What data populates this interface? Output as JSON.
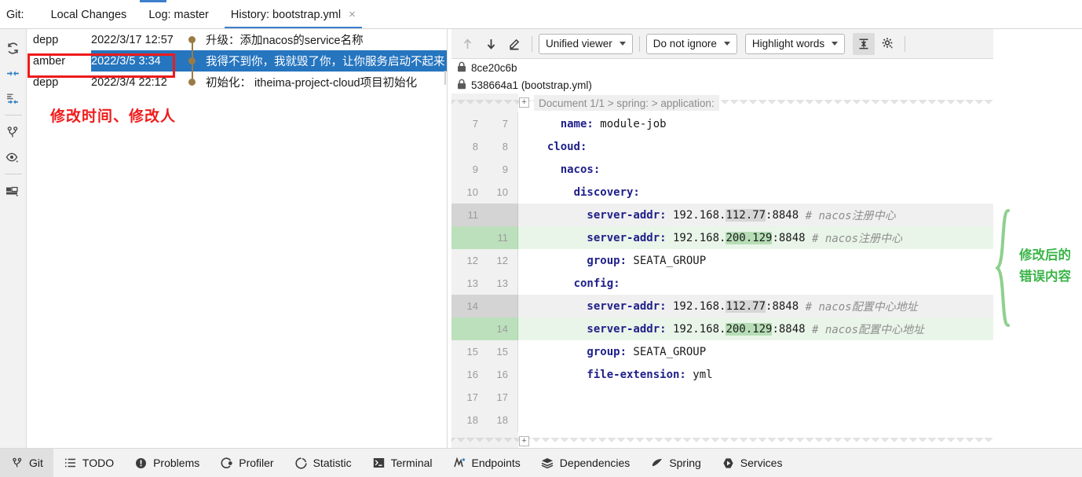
{
  "tabbar": {
    "git_label": "Git:",
    "tabs": [
      {
        "label": "Local Changes",
        "active": false
      },
      {
        "label": "Log: master",
        "active": false
      },
      {
        "label": "History: bootstrap.yml",
        "active": true,
        "close": "×"
      }
    ]
  },
  "rail": {
    "icons": [
      {
        "name": "refresh-icon"
      },
      {
        "name": "collapse-all-icon"
      },
      {
        "name": "expand-selection-icon"
      },
      {
        "name": "branch-icon"
      },
      {
        "name": "eye-icon"
      },
      {
        "name": "layout-icon"
      }
    ]
  },
  "history": {
    "rows": [
      {
        "author": "depp",
        "date": "2022/3/17 12:57",
        "message": "升级：添加nacos的service名称",
        "selected": false
      },
      {
        "author": "amber",
        "date": "2022/3/5 3:34",
        "message": "我得不到你，我就毁了你，让你服务启动不起来",
        "selected": true
      },
      {
        "author": "depp",
        "date": "2022/3/4 22:12",
        "message": "初始化： itheima-project-cloud项目初始化",
        "selected": false
      }
    ]
  },
  "annotations": {
    "left_red_text": "修改时间、修改人",
    "left_red_color": "#f01c1c",
    "right_green_line1": "修改后的",
    "right_green_line2": "错误内容",
    "right_green_color": "#3cb54a"
  },
  "diff": {
    "toolbar": {
      "prev_diff": "up-arrow-icon",
      "next_diff": "down-arrow-icon",
      "edit_source": "pencil-icon",
      "viewer_mode": "Unified viewer",
      "ignore_mode": "Do not ignore",
      "highlight_mode": "Highlight words",
      "collapse_unchanged": "collapse-lines-icon",
      "settings": "gear-icon"
    },
    "revisions": [
      {
        "icon": "lock-icon",
        "label": "8ce20c6b"
      },
      {
        "icon": "lock-icon",
        "label": "538664a1 (bootstrap.yml)"
      }
    ],
    "breadcrumb": "Document 1/1 > spring: > application:",
    "fold_button": "+",
    "lines": [
      {
        "kind": "ctx",
        "ln_left": "7",
        "ln_right": "7",
        "indent": 4,
        "key": "name:",
        "value": " module-job",
        "comment": ""
      },
      {
        "kind": "ctx",
        "ln_left": "8",
        "ln_right": "8",
        "indent": 2,
        "key": "cloud:",
        "value": "",
        "comment": ""
      },
      {
        "kind": "ctx",
        "ln_left": "9",
        "ln_right": "9",
        "indent": 4,
        "key": "nacos:",
        "value": "",
        "comment": ""
      },
      {
        "kind": "ctx",
        "ln_left": "10",
        "ln_right": "10",
        "indent": 6,
        "key": "discovery:",
        "value": "",
        "comment": ""
      },
      {
        "kind": "del",
        "ln_left": "11",
        "ln_right": "",
        "indent": 8,
        "key": "server-addr:",
        "value_pre": " 192.168.",
        "value_hl": "112.77",
        "value_post": ":8848",
        "comment": " # nacos注册中心"
      },
      {
        "kind": "add",
        "ln_left": "",
        "ln_right": "11",
        "indent": 8,
        "key": "server-addr:",
        "value_pre": " 192.168.",
        "value_hl": "200.129",
        "value_post": ":8848",
        "comment": " # nacos注册中心"
      },
      {
        "kind": "ctx",
        "ln_left": "12",
        "ln_right": "12",
        "indent": 8,
        "key": "group:",
        "value": " SEATA_GROUP",
        "comment": ""
      },
      {
        "kind": "ctx",
        "ln_left": "13",
        "ln_right": "13",
        "indent": 6,
        "key": "config:",
        "value": "",
        "comment": ""
      },
      {
        "kind": "del",
        "ln_left": "14",
        "ln_right": "",
        "indent": 8,
        "key": "server-addr:",
        "value_pre": " 192.168.",
        "value_hl": "112.77",
        "value_post": ":8848",
        "comment": " # nacos配置中心地址"
      },
      {
        "kind": "add",
        "ln_left": "",
        "ln_right": "14",
        "indent": 8,
        "key": "server-addr:",
        "value_pre": " 192.168.",
        "value_hl": "200.129",
        "value_post": ":8848",
        "comment": " # nacos配置中心地址"
      },
      {
        "kind": "ctx",
        "ln_left": "15",
        "ln_right": "15",
        "indent": 8,
        "key": "group:",
        "value": " SEATA_GROUP",
        "comment": ""
      },
      {
        "kind": "ctx",
        "ln_left": "16",
        "ln_right": "16",
        "indent": 8,
        "key": "file-extension:",
        "value": " yml",
        "comment": ""
      },
      {
        "kind": "ctx",
        "ln_left": "17",
        "ln_right": "17",
        "indent": 0,
        "key": "",
        "value": "",
        "comment": ""
      },
      {
        "kind": "ctx",
        "ln_left": "18",
        "ln_right": "18",
        "indent": 0,
        "key": "",
        "value": "",
        "comment": ""
      }
    ],
    "colors": {
      "deleted_bg": "#f0f0f0",
      "deleted_gutter": "#d4d4d4",
      "added_bg": "#e9f5e9",
      "added_gutter": "#bce0bc",
      "keyword": "#20208a",
      "comment": "#8d8d8d"
    }
  },
  "statusbar": {
    "items": [
      {
        "icon": "git-branch-icon",
        "label": "Git",
        "active": true
      },
      {
        "icon": "list-icon",
        "label": "TODO",
        "active": false
      },
      {
        "icon": "warning-icon",
        "label": "Problems",
        "active": false
      },
      {
        "icon": "profiler-icon",
        "label": "Profiler",
        "active": false
      },
      {
        "icon": "pie-chart-icon",
        "label": "Statistic",
        "active": false
      },
      {
        "icon": "terminal-icon",
        "label": "Terminal",
        "active": false
      },
      {
        "icon": "endpoints-icon",
        "label": "Endpoints",
        "active": false
      },
      {
        "icon": "layers-icon",
        "label": "Dependencies",
        "active": false
      },
      {
        "icon": "leaf-icon",
        "label": "Spring",
        "active": false
      },
      {
        "icon": "play-icon",
        "label": "Services",
        "active": false
      }
    ]
  }
}
